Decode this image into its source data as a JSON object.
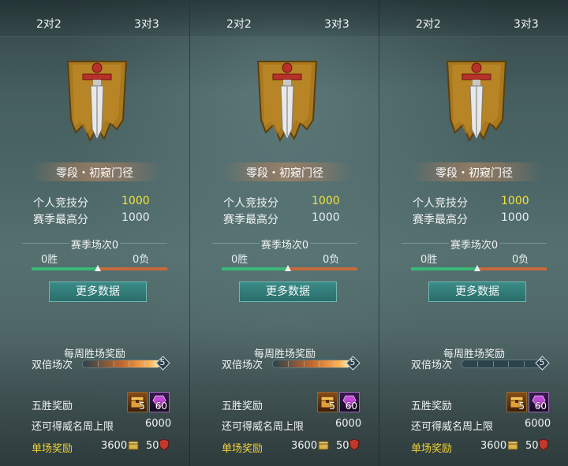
{
  "panels": [
    {
      "tabs": [
        "2对2",
        "3对3"
      ],
      "rank_title": "零段・初窥门径",
      "personal_score_label": "个人竞技分",
      "personal_score": "1000",
      "season_best_label": "赛季最高分",
      "season_best": "1000",
      "season_games": "赛季场次0",
      "wins": "0胜",
      "losses": "0负",
      "more_data_label": "更多数据",
      "weekly_title": "每周胜场奖励",
      "double_label": "双倍场次",
      "double_count": "5",
      "double_progress": 1.0,
      "five_win_label": "五胜奖励",
      "five_win_items": [
        {
          "name": "chest-icon",
          "qty": "5"
        },
        {
          "name": "gem-icon",
          "qty": "60"
        }
      ],
      "cap_label": "还可得威名周上限",
      "cap_value": "6000",
      "single_label": "单场奖励",
      "single_gold": "3600",
      "single_points": "50"
    },
    {
      "tabs": [
        "2对2",
        "3对3"
      ],
      "rank_title": "零段・初窥门径",
      "personal_score_label": "个人竞技分",
      "personal_score": "1000",
      "season_best_label": "赛季最高分",
      "season_best": "1000",
      "season_games": "赛季场次0",
      "wins": "0胜",
      "losses": "0负",
      "more_data_label": "更多数据",
      "weekly_title": "每周胜场奖励",
      "double_label": "双倍场次",
      "double_count": "5",
      "double_progress": 1.0,
      "five_win_label": "五胜奖励",
      "five_win_items": [
        {
          "name": "chest-icon",
          "qty": "5"
        },
        {
          "name": "gem-icon",
          "qty": "60"
        }
      ],
      "cap_label": "还可得威名周上限",
      "cap_value": "6000",
      "single_label": "单场奖励",
      "single_gold": "3600",
      "single_points": "50"
    },
    {
      "tabs": [
        "2对2",
        "3对3"
      ],
      "rank_title": "零段・初窥门径",
      "personal_score_label": "个人竞技分",
      "personal_score": "1000",
      "season_best_label": "赛季最高分",
      "season_best": "1000",
      "season_games": "赛季场次0",
      "wins": "0胜",
      "losses": "0负",
      "more_data_label": "更多数据",
      "weekly_title": "每周胜场奖励",
      "double_label": "双倍场次",
      "double_count": "5",
      "double_progress": 0.0,
      "five_win_label": "五胜奖励",
      "five_win_items": [
        {
          "name": "chest-icon",
          "qty": "5"
        },
        {
          "name": "gem-icon",
          "qty": "60"
        }
      ],
      "cap_label": "还可得威名周上限",
      "cap_value": "6000",
      "single_label": "单场奖励",
      "single_gold": "3600",
      "single_points": "50"
    }
  ],
  "colors": {
    "score_highlight": "#f3e53a",
    "single_reward_label": "#f0d338",
    "win_bar": "#3bb877",
    "loss_bar": "#c46a3c",
    "button": "#2f7c78"
  },
  "win_ratio": 0.5
}
